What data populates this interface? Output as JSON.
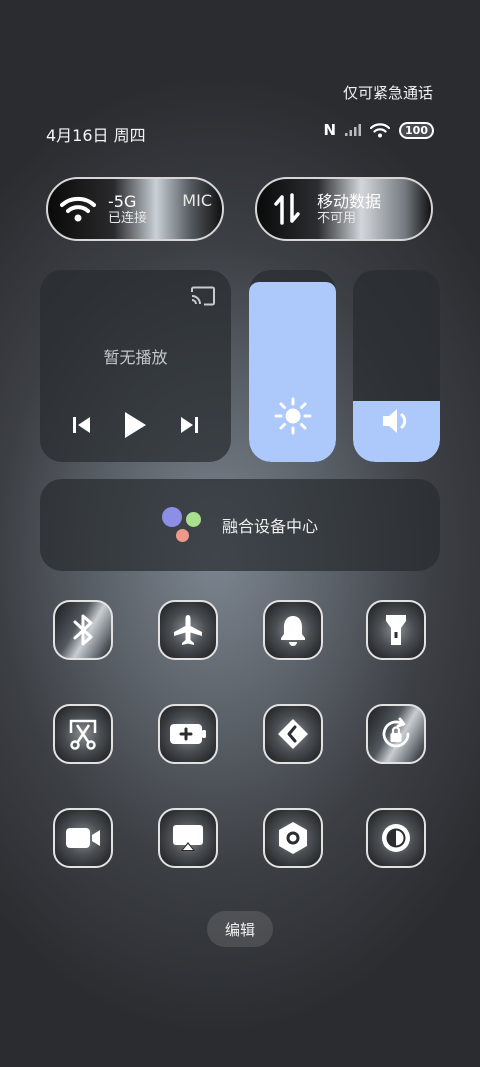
{
  "header": {
    "emergency_text": "仅可紧急通话",
    "date_text": "4月16日 周四",
    "nfc_label": "N",
    "battery_label": "100"
  },
  "wifi": {
    "network": "-5G",
    "status": "已连接",
    "extra": "MIC"
  },
  "mobile_data": {
    "title": "移动数据",
    "status": "不可用"
  },
  "media": {
    "status": "暂无播放"
  },
  "brightness": {
    "level": 0.94
  },
  "volume": {
    "level": 0.32
  },
  "fusion": {
    "label": "融合设备中心"
  },
  "edit": {
    "label": "编辑"
  },
  "colors": {
    "accent": "#adc8fb",
    "tile_border": "#e2e2e2"
  },
  "toggles": [
    {
      "name": "bluetooth-icon",
      "state": "on"
    },
    {
      "name": "airplane-icon",
      "state": "off"
    },
    {
      "name": "bell-icon",
      "state": "off"
    },
    {
      "name": "flashlight-icon",
      "state": "off"
    },
    {
      "name": "screenshot-scissors-icon",
      "state": "off"
    },
    {
      "name": "battery-saver-icon",
      "state": "off"
    },
    {
      "name": "link-share-icon",
      "state": "off"
    },
    {
      "name": "rotation-lock-icon",
      "state": "on"
    },
    {
      "name": "video-camera-icon",
      "state": "off"
    },
    {
      "name": "screen-cast-icon",
      "state": "off"
    },
    {
      "name": "settings-hex-icon",
      "state": "off"
    },
    {
      "name": "dark-mode-icon",
      "state": "off"
    }
  ]
}
